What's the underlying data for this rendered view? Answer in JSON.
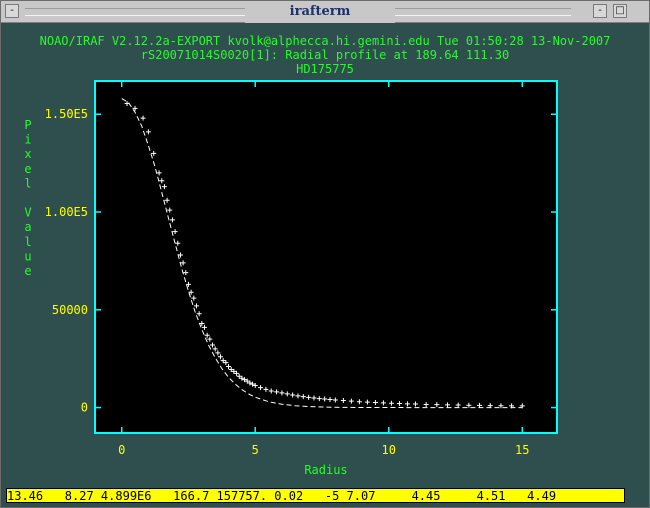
{
  "window": {
    "title": "irafterm",
    "left_button": "-",
    "right_buttons": [
      "-",
      "□"
    ]
  },
  "header": {
    "line1": "NOAO/IRAF V2.12.2a-EXPORT kvolk@alphecca.hi.gemini.edu Tue 01:50:28 13-Nov-2007",
    "line2": "rS20071014S0020[1]: Radial profile at 189.64 111.30",
    "line3": "HD175775"
  },
  "status_line": "13.46   8.27 4.899E6   166.7 157757. 0.02   -5 7.07     4.45     4.51   4.49",
  "colors": {
    "frame": "#00ffff",
    "ticks": "#ffff00",
    "labels": "#22ff22",
    "data": "#ffffff",
    "status_bg": "#ffff00"
  },
  "chart_data": {
    "type": "scatter",
    "title": "HD175775",
    "xlabel": "Radius",
    "ylabel": "Pixel Value",
    "xlim": [
      -1,
      16.3
    ],
    "ylim": [
      -13000,
      167000
    ],
    "xticks": [
      0,
      5,
      10,
      15
    ],
    "xtick_labels": [
      "0",
      "5",
      "10",
      "15"
    ],
    "yticks": [
      0,
      50000,
      100000,
      150000
    ],
    "ytick_labels": [
      "0",
      "50000",
      "1.00E5",
      "1.50E5"
    ],
    "series": [
      {
        "kind": "points",
        "x": [
          0.2,
          0.5,
          0.8,
          1.0,
          1.2,
          1.4,
          1.5,
          1.6,
          1.7,
          1.8,
          1.9,
          2.0,
          2.1,
          2.2,
          2.3,
          2.4,
          2.5,
          2.6,
          2.7,
          2.8,
          2.9,
          3.0,
          3.1,
          3.2,
          3.3,
          3.4,
          3.5,
          3.6,
          3.7,
          3.8,
          3.9,
          4.0,
          4.1,
          4.2,
          4.3,
          4.4,
          4.5,
          4.6,
          4.7,
          4.8,
          4.9,
          5.0,
          5.2,
          5.4,
          5.6,
          5.8,
          6.0,
          6.2,
          6.4,
          6.6,
          6.8,
          7.0,
          7.2,
          7.4,
          7.6,
          7.8,
          8.0,
          8.3,
          8.6,
          8.9,
          9.2,
          9.5,
          9.8,
          10.1,
          10.4,
          10.7,
          11.0,
          11.4,
          11.8,
          12.2,
          12.6,
          13.0,
          13.4,
          13.8,
          14.2,
          14.6,
          15.0
        ],
        "y": [
          155500,
          153000,
          148000,
          141000,
          130000,
          120000,
          116000,
          113000,
          106000,
          101000,
          96000,
          90000,
          84000,
          78000,
          74000,
          69000,
          63000,
          59000,
          56000,
          52000,
          48000,
          43000,
          41000,
          37000,
          35000,
          32000,
          30000,
          28000,
          26000,
          24000,
          23000,
          21000,
          19500,
          18500,
          17500,
          16000,
          15000,
          14300,
          13500,
          12600,
          12000,
          11300,
          10200,
          9300,
          8500,
          8000,
          7500,
          7000,
          6400,
          6000,
          5600,
          5200,
          4900,
          4600,
          4400,
          4100,
          3900,
          3600,
          3300,
          3000,
          2800,
          2600,
          2400,
          2200,
          2100,
          1900,
          1800,
          1600,
          1500,
          1400,
          1300,
          1200,
          1100,
          1000,
          950,
          900,
          850
        ]
      },
      {
        "kind": "line",
        "x": [
          0,
          0.25,
          0.5,
          0.75,
          1.0,
          1.25,
          1.5,
          1.75,
          2.0,
          2.25,
          2.5,
          2.75,
          3.0,
          3.25,
          3.5,
          3.75,
          4.0,
          4.25,
          4.5,
          4.75,
          5.0,
          5.5,
          6.0,
          6.5,
          7.0,
          7.5,
          8.0,
          9.0,
          10.0,
          11.0,
          12.0,
          13.0,
          14.0,
          15.0
        ],
        "y": [
          158000,
          156000,
          151000,
          144000,
          134000,
          123000,
          110000,
          97000,
          84000,
          71000,
          59500,
          49000,
          40000,
          32000,
          25500,
          20000,
          15500,
          12000,
          9200,
          7000,
          5300,
          3000,
          1700,
          950,
          520,
          290,
          160,
          50,
          15,
          5,
          2,
          1,
          0,
          0
        ]
      }
    ]
  }
}
